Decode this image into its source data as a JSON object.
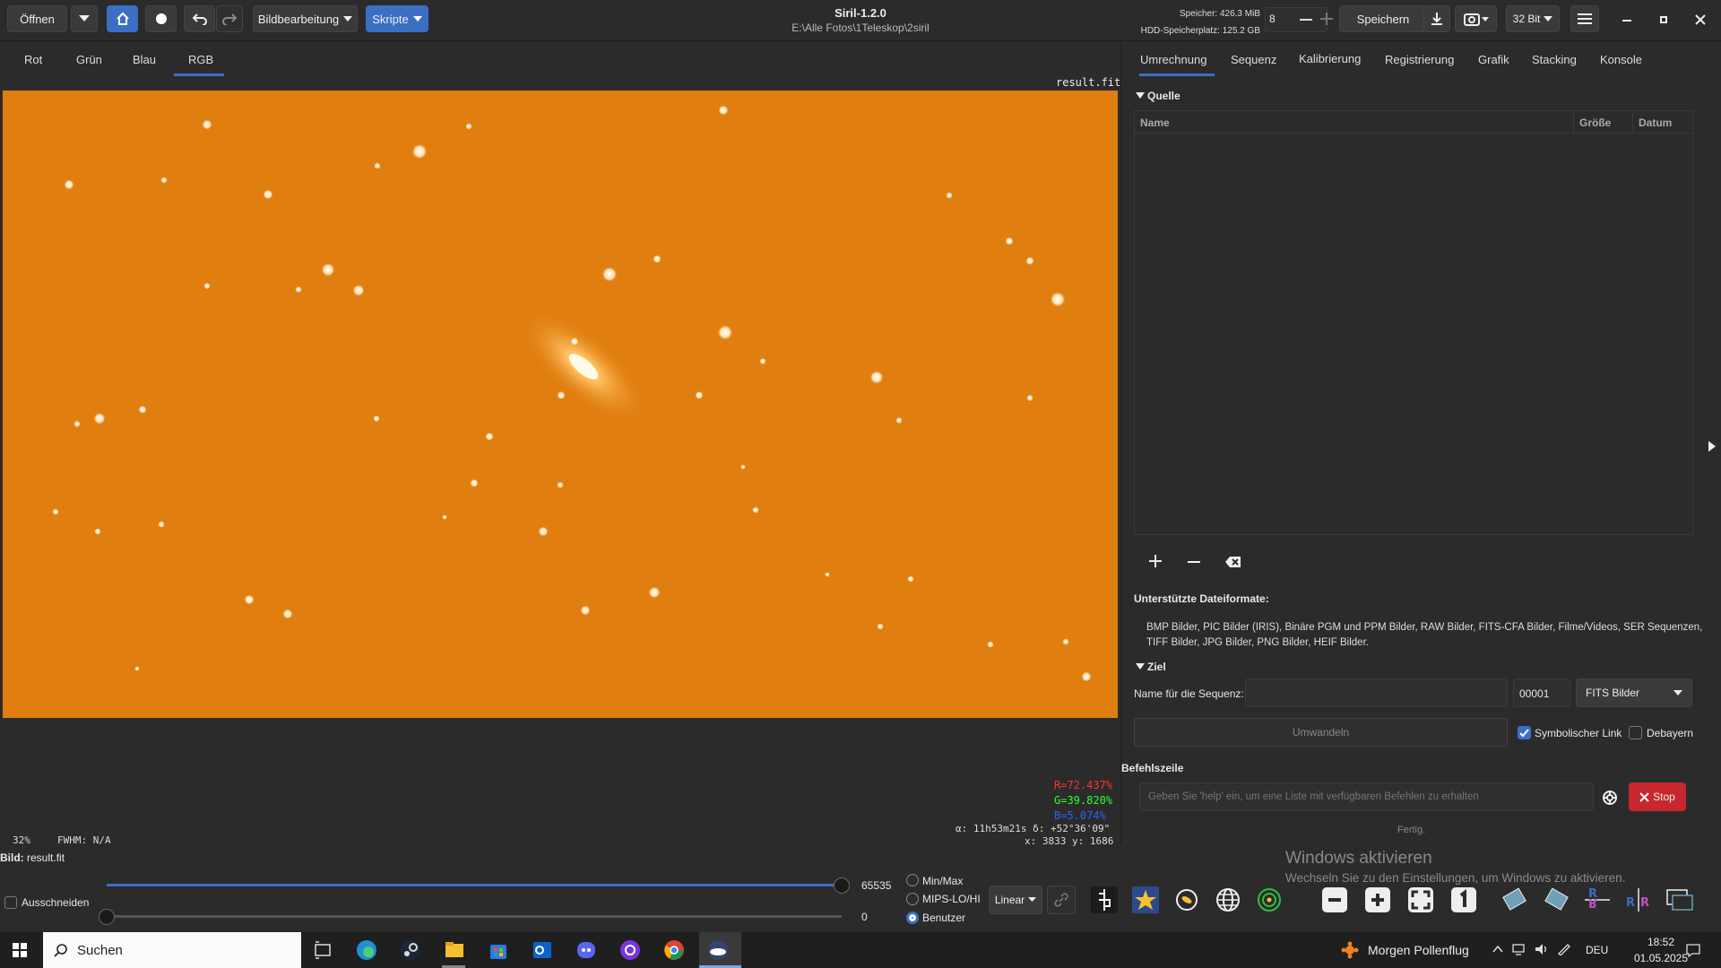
{
  "window": {
    "title": "Siril-1.2.0",
    "path": "E:\\Alle Fotos\\1Teleskop\\2siril"
  },
  "toolbar": {
    "open": "Öffnen",
    "image_processing": "Bildbearbeitung",
    "scripts": "Skripte",
    "memory_label": "Speicher: 426.3 MiB",
    "disk_label": "HDD-Speicherplatz: 125.2 GB",
    "threads_value": "8",
    "save": "Speichern",
    "bitdepth": "32 Bit"
  },
  "channel_tabs": [
    "Rot",
    "Grün",
    "Blau",
    "RGB"
  ],
  "image": {
    "filename": "result.fit",
    "zoom": "32%",
    "fwhm": "FWHM: N/A",
    "r": "R=72.437%",
    "g": "G=39.820%",
    "b": "B=5.074%",
    "coords1": "α: 11h53m21s  δ: +52°36'09\"",
    "coords2": "x: 3833 y: 1686",
    "caption_prefix": "Bild:",
    "caption_file": "result.fit"
  },
  "right_tabs": [
    "Umrechnung",
    "Sequenz",
    "Kalibrierung",
    "Registrierung",
    "Grafik",
    "Stacking",
    "Konsole"
  ],
  "source": {
    "section": "Quelle",
    "col_name": "Name",
    "col_size": "Größe",
    "col_date": "Datum",
    "formats_title": "Unterstützte Dateiformate:",
    "formats_line1": "BMP Bilder, PIC Bilder (IRIS), Binäre PGM und PPM Bilder, RAW Bilder, FITS-CFA Bilder, Filme/Videos, SER Sequenzen,",
    "formats_line2": "TIFF Bilder, JPG Bilder, PNG Bilder, HEIF Bilder."
  },
  "target": {
    "section": "Ziel",
    "seq_label": "Name für die Sequenz:",
    "seq_value": "",
    "index_value": "00001",
    "format": "FITS Bilder",
    "convert": "Umwandeln",
    "symlink": "Symbolischer Link",
    "debayer": "Debayern"
  },
  "command": {
    "label": "Befehlszeile",
    "placeholder": "Geben Sie 'help' ein, um eine Liste mit verfügbaren Befehlen zu erhalten",
    "stop": "Stop",
    "status": "Fertig."
  },
  "bottom": {
    "crop": "Ausschneiden",
    "max_val": "65535",
    "min_val": "0",
    "radio_minmax": "Min/Max",
    "radio_mips": "MIPS-LO/HI",
    "radio_user": "Benutzer",
    "stretch": "Linear"
  },
  "watermark": {
    "title": "Windows aktivieren",
    "sub": "Wechseln Sie zu den Einstellungen, um Windows zu aktivieren."
  },
  "taskbar": {
    "search": "Suchen",
    "weather": "Morgen Pollenflug",
    "lang": "DEU",
    "time": "18:52",
    "date": "01.05.2025"
  },
  "colors": {
    "accent": "#3a6fc4",
    "image_bg": "#e07e10",
    "stop": "#c8282d",
    "r": "#ff3030",
    "g": "#30ff30",
    "b": "#3060ff"
  }
}
